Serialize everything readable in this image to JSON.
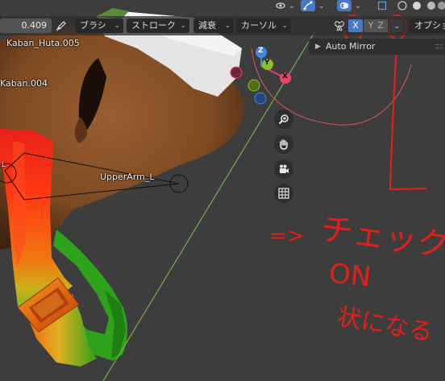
{
  "header": {
    "strength_value": "0.409",
    "brush_label": "ブラシ",
    "stroke_label": "ストローク",
    "falloff_label": "減衰",
    "cursor_label": "カーソル",
    "options_label": "オプショ",
    "axes": {
      "x": "X",
      "y": "Y",
      "z": "Z"
    }
  },
  "auto_mirror": {
    "label": "Auto Mirror"
  },
  "objects": {
    "kaban_huta": "Kaban_Huta.005",
    "kaban": "Kaban.004",
    "bone": "UpperArm_L",
    "bone_tip": "L"
  },
  "gizmo": {
    "x": "X",
    "y": "Y",
    "z": "Z"
  },
  "annotation": {
    "arrow_text": "=>",
    "check": "チェック",
    "on": "ON",
    "result": "状になる"
  },
  "colors": {
    "annotation": "#e0201a",
    "axis_x": "#e8436a",
    "axis_y": "#8cbf2a",
    "axis_z": "#3d86e6",
    "axis_active": "#4a78c8"
  }
}
